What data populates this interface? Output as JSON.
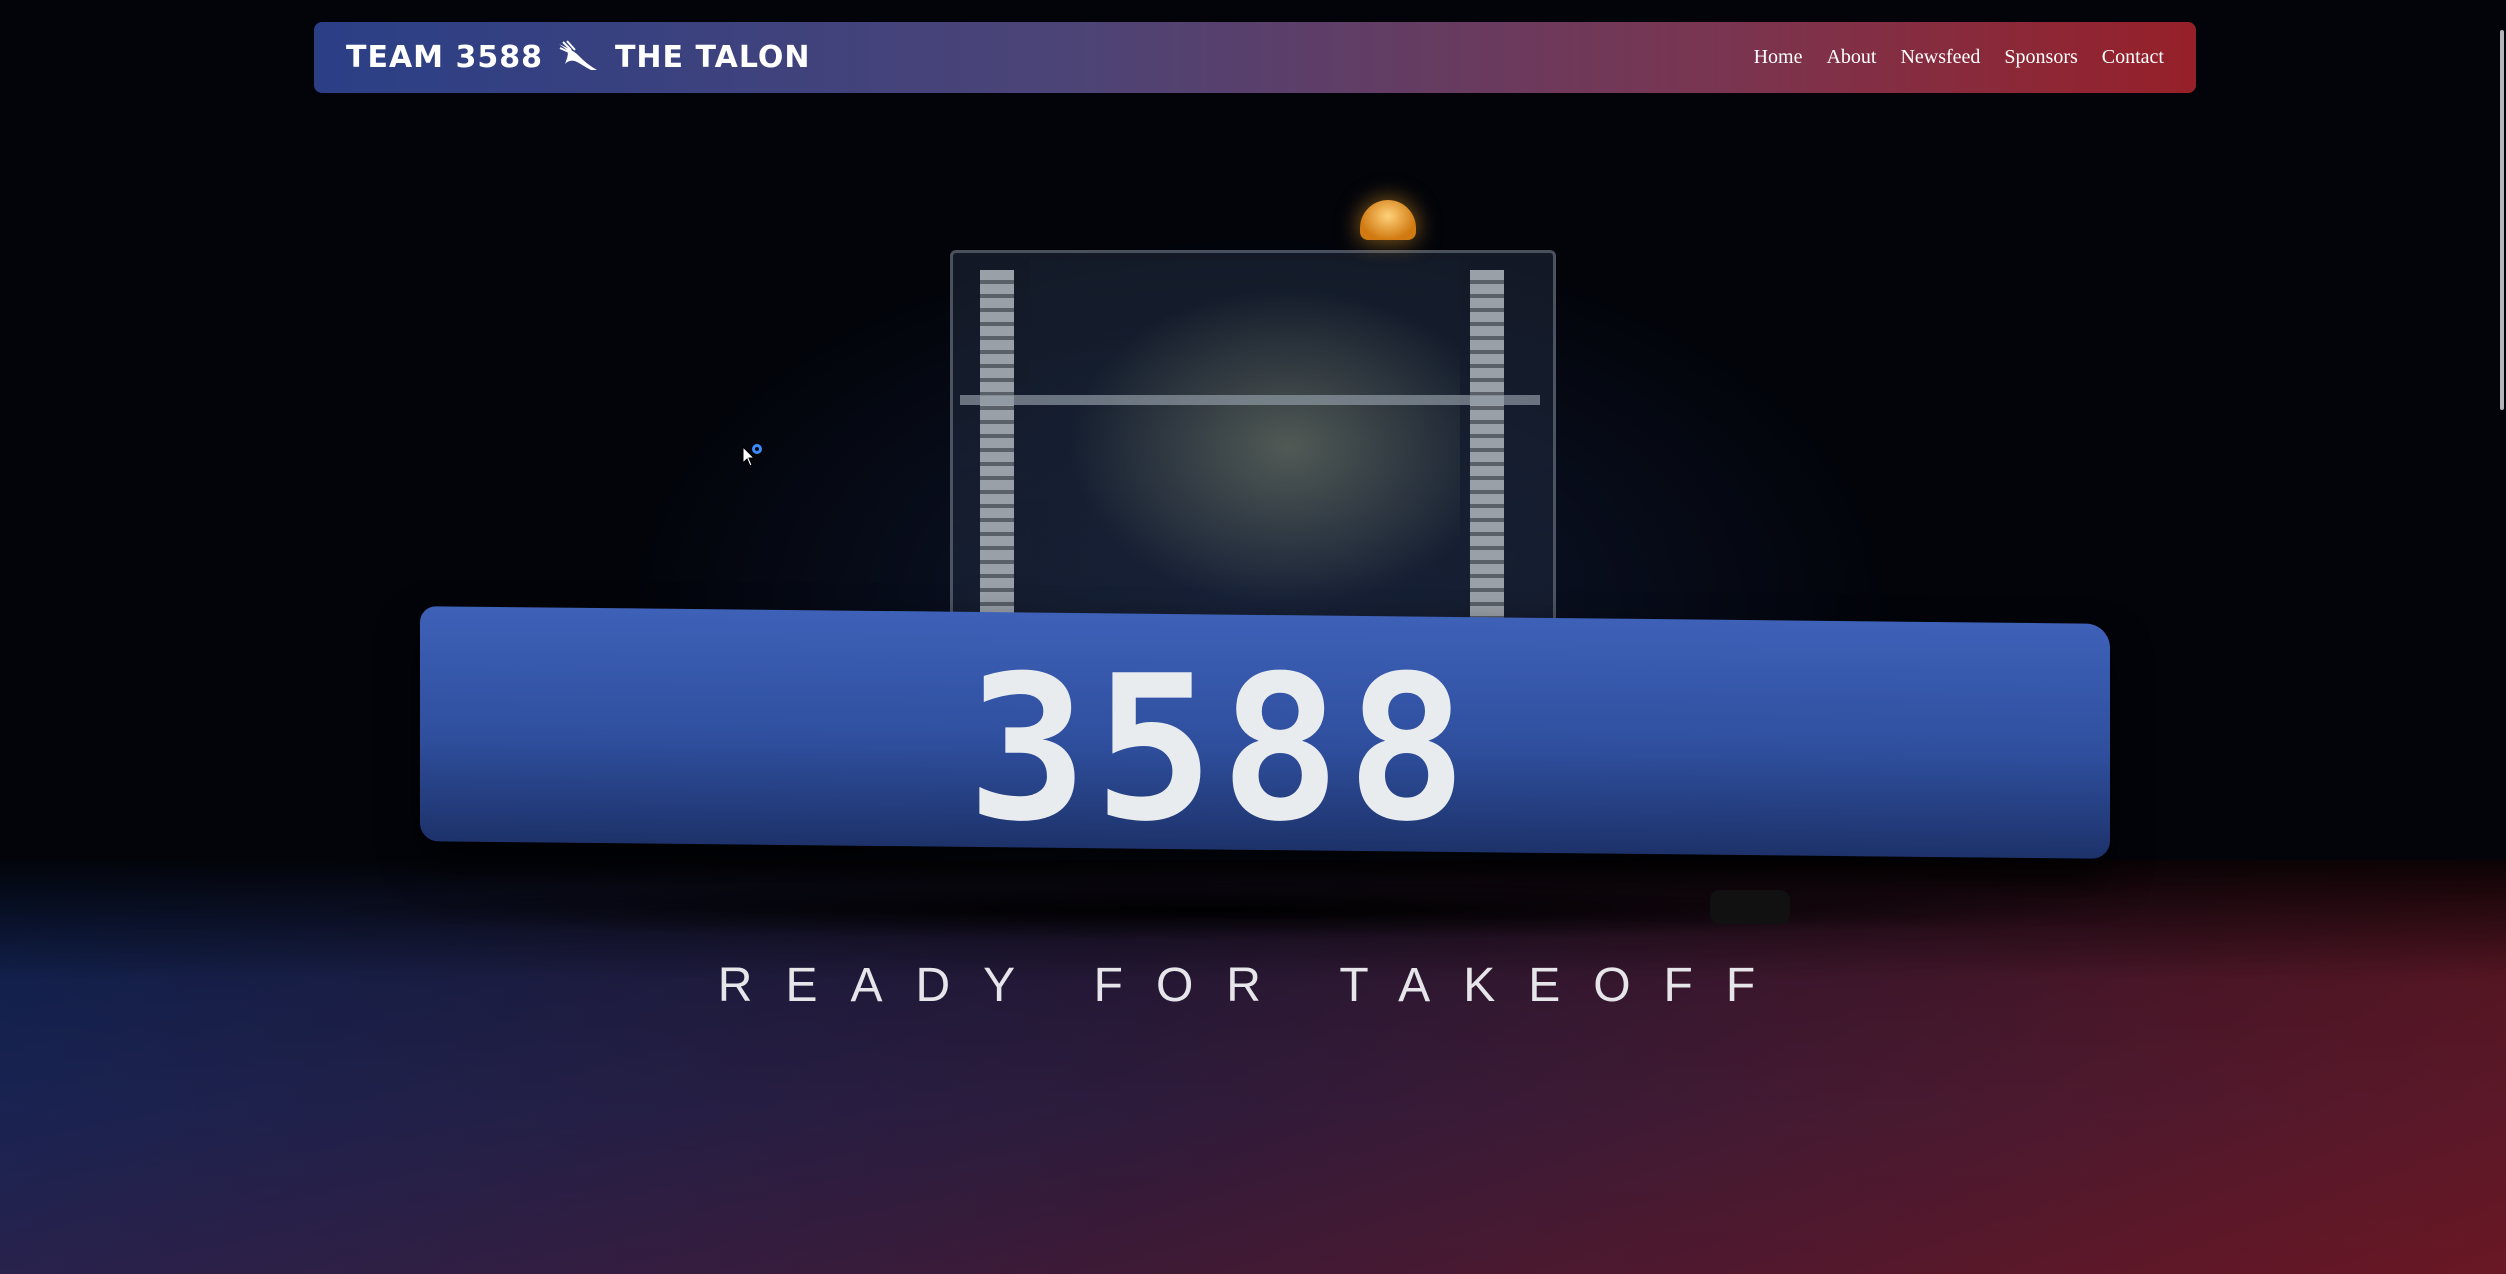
{
  "navbar": {
    "brand_left": "TEAM 3588",
    "brand_right": "THE TALON",
    "brand_icon": "talon-bird-icon",
    "links": [
      {
        "label": "Home"
      },
      {
        "label": "About"
      },
      {
        "label": "Newsfeed"
      },
      {
        "label": "Sponsors"
      },
      {
        "label": "Contact"
      }
    ],
    "gradient_colors": [
      "#2b3f86",
      "#962029"
    ]
  },
  "hero": {
    "robot_number": "3588",
    "tagline": "READY FOR TAKEOFF"
  },
  "colors": {
    "bumper": "#3e61b8",
    "text": "#e6e6ea"
  }
}
